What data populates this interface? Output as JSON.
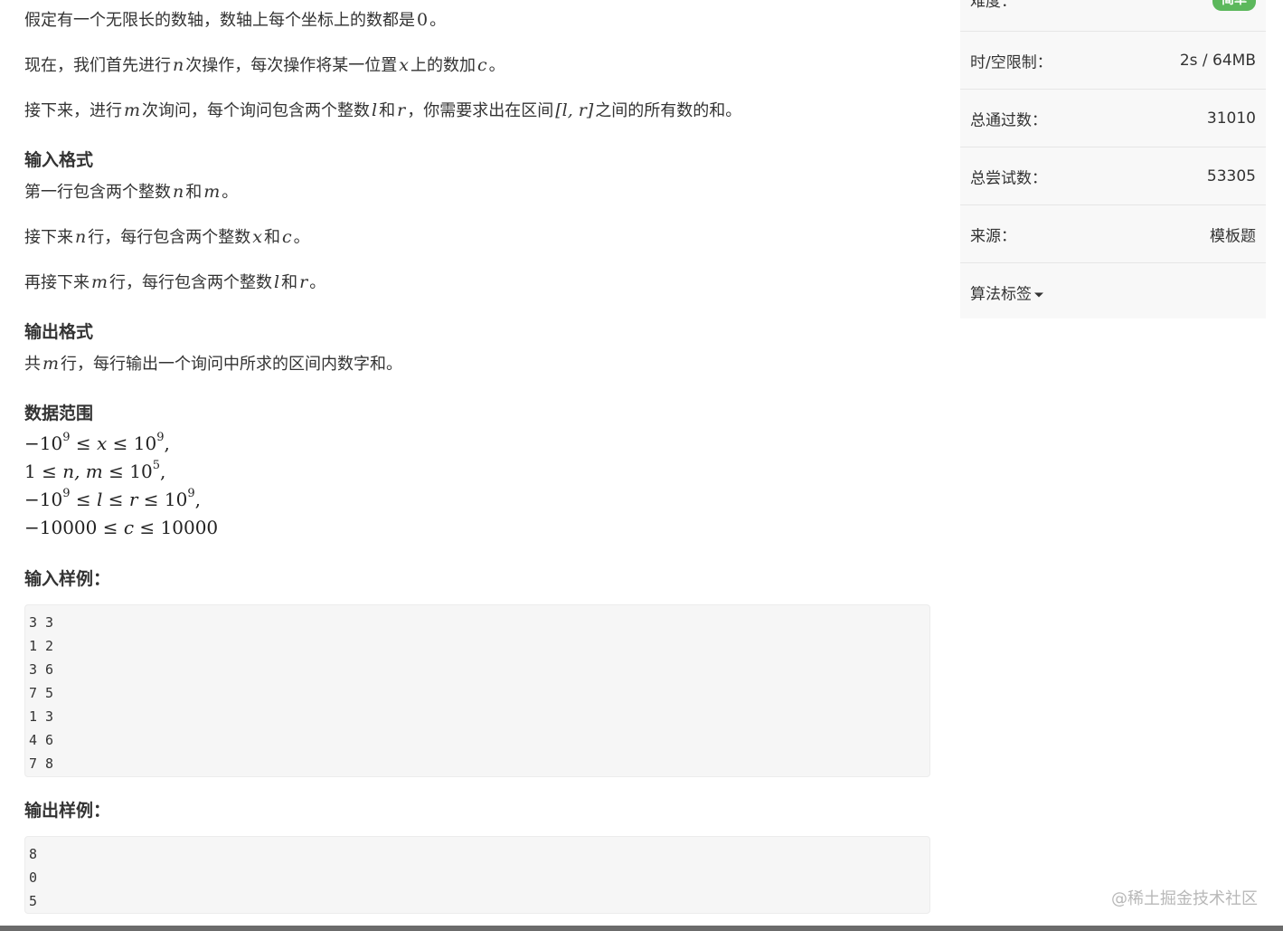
{
  "problem": {
    "p1": {
      "a": "假定有一个无限长的数轴，数轴上每个坐标上的数都是",
      "v0": "0",
      "b": "。"
    },
    "p2": {
      "a": "现在，我们首先进行",
      "n": "n",
      "b": "次操作，每次操作将某一位置",
      "x": "x",
      "c": "上的数加",
      "cv": "c",
      "d": "。"
    },
    "p3": {
      "a": "接下来，进行",
      "m": "m",
      "b": "次询问，每个询问包含两个整数",
      "l": "l",
      "c": "和",
      "r": "r",
      "d": "，你需要求出在区间",
      "range": "[l, r]",
      "e": "之间的所有数的和。"
    },
    "input_heading": "输入格式",
    "i1": {
      "a": "第一行包含两个整数",
      "n": "n",
      "b": "和",
      "m": "m",
      "c": "。"
    },
    "i2": {
      "a": "接下来",
      "n": "n",
      "b": "行，每行包含两个整数",
      "x": "x",
      "c": "和",
      "cv": "c",
      "d": "。"
    },
    "i3": {
      "a": "再接下来",
      "m": "m",
      "b": "行，每行包含两个整数",
      "l": "l",
      "c": "和",
      "r": "r",
      "d": "。"
    },
    "output_heading": "输出格式",
    "o1": {
      "a": "共",
      "m": "m",
      "b": "行，每行输出一个询问中所求的区间内数字和。"
    },
    "range_heading": "数据范围",
    "r1": {
      "a": "−10",
      "e1": "9",
      "b": " ≤ ",
      "v": "x",
      "c": " ≤ 10",
      "e2": "9",
      "d": ","
    },
    "r2": {
      "a": "1 ≤ ",
      "v": "n, m",
      "b": " ≤ 10",
      "e": "5",
      "c": ","
    },
    "r3": {
      "a": "−10",
      "e1": "9",
      "b": " ≤ ",
      "v1": "l",
      "c": " ≤ ",
      "v2": "r",
      "d": " ≤ 10",
      "e2": "9",
      "f": ","
    },
    "r4": {
      "a": "−10000 ≤ ",
      "v": "c",
      "b": " ≤ 10000"
    },
    "sample_in_heading": "输入样例：",
    "sample_in": [
      "3 3",
      "1 2",
      "3 6",
      "7 5",
      "1 3",
      "4 6",
      "7 8"
    ],
    "sample_out_heading": "输出样例：",
    "sample_out": [
      "8",
      "0",
      "5"
    ]
  },
  "sidebar": {
    "difficulty": {
      "label": "难度：",
      "value": "简单"
    },
    "limit": {
      "label": "时/空限制：",
      "value": "2s / 64MB"
    },
    "passed": {
      "label": "总通过数：",
      "value": "31010"
    },
    "attempts": {
      "label": "总尝试数：",
      "value": "53305"
    },
    "source": {
      "label": "来源：",
      "value": "模板题"
    },
    "tags": {
      "label": "算法标签"
    }
  },
  "watermark": "@稀土掘金技术社区",
  "colors": {
    "badge": "#5cb85c",
    "sidebar_bg": "#f8f8f8",
    "code_bg": "#f6f6f6"
  }
}
